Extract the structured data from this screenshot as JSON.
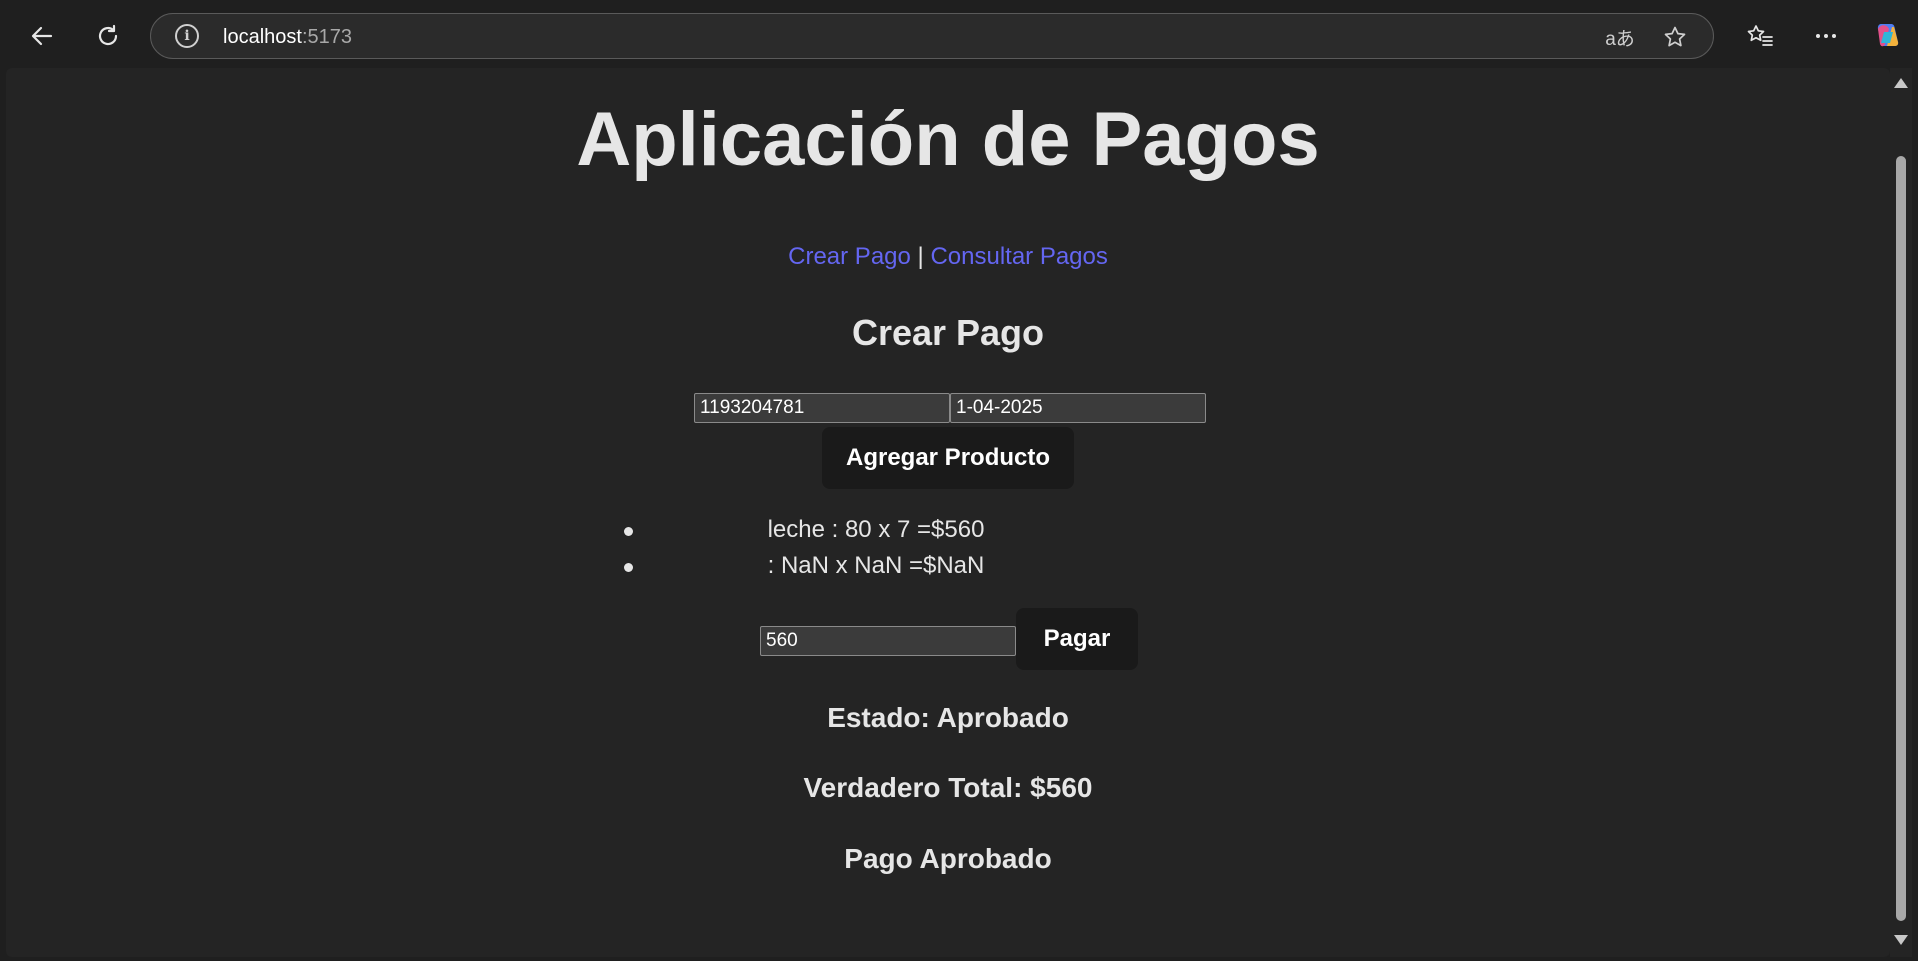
{
  "browser": {
    "address_host": "localhost",
    "address_port": ":5173",
    "translate_icon_text": "aあ"
  },
  "page": {
    "title": "Aplicación de Pagos",
    "nav": {
      "crear_pago": "Crear Pago",
      "separator": "|",
      "consultar_pagos": "Consultar Pagos"
    },
    "section_title": "Crear Pago",
    "form": {
      "client_id_value": "1193204781",
      "date_value": "1-04-2025",
      "add_product_label": "Agregar Producto"
    },
    "products": [
      {
        "text": "leche : 80 x 7 =$560"
      },
      {
        "text": ": NaN x NaN =$NaN"
      }
    ],
    "payment": {
      "amount_value": "560",
      "pay_label": "Pagar"
    },
    "estado": "Estado: Aprobado",
    "verdadero_total": "Verdadero Total: $560",
    "pago_aprobado": "Pago Aprobado"
  },
  "colors": {
    "background": "#242424",
    "link": "#6466f1",
    "button_bg": "#1a1a1a"
  }
}
